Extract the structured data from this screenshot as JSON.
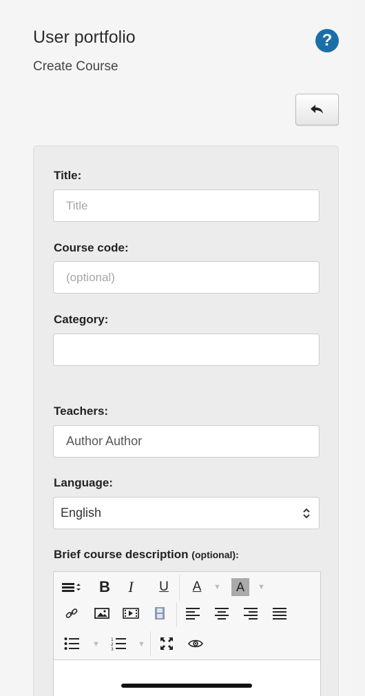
{
  "header": {
    "title": "User portfolio",
    "subtitle": "Create Course",
    "help_icon": "question-circle-icon",
    "back_icon": "reply-arrow-icon"
  },
  "form": {
    "title_label": "Title:",
    "title_placeholder": "Title",
    "code_label": "Course code:",
    "code_placeholder": "(optional)",
    "category_label": "Category:",
    "category_value": "",
    "teachers_label": "Teachers:",
    "teachers_value": "Author Author",
    "language_label": "Language:",
    "language_value": "English",
    "description_label": "Brief course description",
    "description_optional": "(optional):"
  },
  "toolbar": {
    "row1": [
      "paragraph-format-icon",
      "bold-icon",
      "italic-icon",
      "underline-icon",
      "font-color-icon",
      "highlight-color-icon"
    ],
    "row2": [
      "link-icon",
      "image-icon",
      "video-icon",
      "film-icon",
      "align-left-icon",
      "align-center-icon",
      "align-right-icon",
      "align-justify-icon"
    ],
    "row3": [
      "unordered-list-icon",
      "ordered-list-icon",
      "fullscreen-icon",
      "preview-icon"
    ],
    "bold_glyph": "B",
    "italic_glyph": "I",
    "underline_glyph": "U",
    "color_glyph": "A"
  },
  "colors": {
    "help_blue": "#1b6fa8",
    "panel_bg": "#ececec"
  }
}
